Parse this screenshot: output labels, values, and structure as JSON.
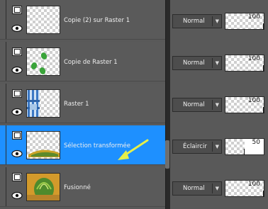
{
  "layers": [
    {
      "name": "Copie (2) sur Raster 1",
      "blend_mode": "Normal",
      "opacity": 100,
      "thumbnail": "transparent-checker",
      "selected": false
    },
    {
      "name": "Copie de Raster 1",
      "blend_mode": "Normal",
      "opacity": 100,
      "thumbnail": "green-leaves",
      "selected": false
    },
    {
      "name": "Raster 1",
      "blend_mode": "Normal",
      "opacity": 100,
      "thumbnail": "blue-plaid",
      "selected": false
    },
    {
      "name": "Sélection transformée",
      "blend_mode": "Éclaircir",
      "opacity": 50,
      "thumbnail": "yellow-selection",
      "selected": true
    },
    {
      "name": "Fusionné",
      "blend_mode": "Normal",
      "opacity": 100,
      "thumbnail": "merged-image",
      "selected": false
    }
  ],
  "icons": {
    "group": "layer-group-icon",
    "visibility": "eye-icon",
    "dropdown": "chevron-down-icon"
  },
  "colors": {
    "selected_row": "#1e90ff",
    "annotation_arrow": "#e6f04a"
  }
}
